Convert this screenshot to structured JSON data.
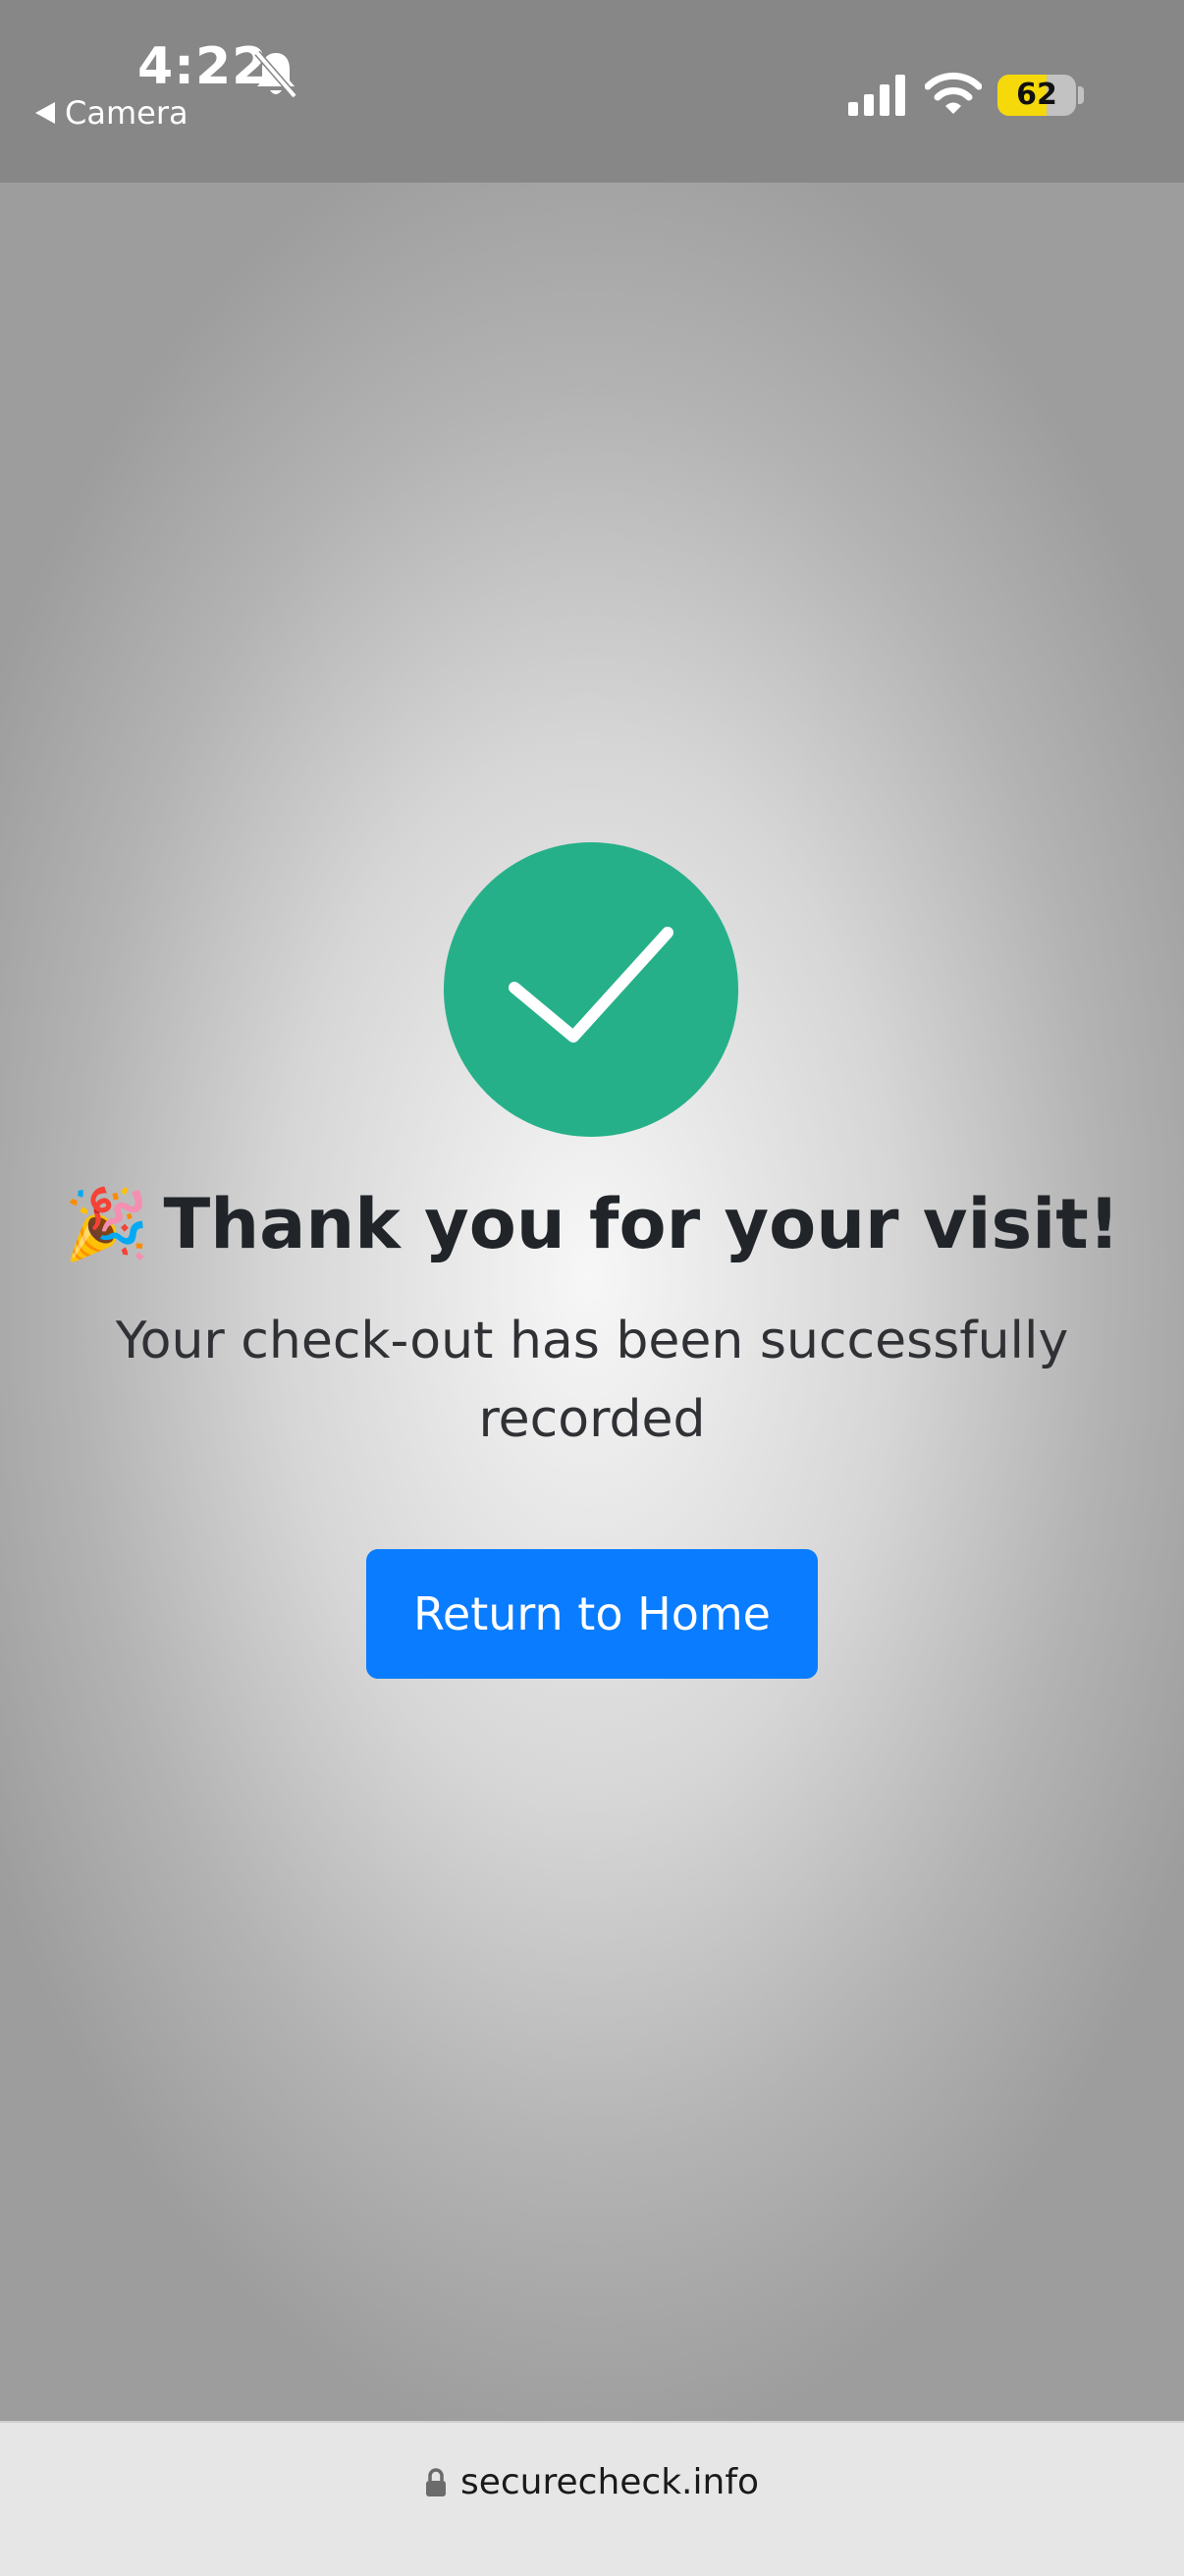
{
  "status_bar": {
    "time": "4:22",
    "back_label": "Camera",
    "battery_level": "62",
    "battery_fraction": 0.62,
    "icons": [
      "bell-slash-icon",
      "cellular-signal-icon",
      "wifi-icon",
      "battery-icon"
    ]
  },
  "main": {
    "success_icon": "checkmark-circle-icon",
    "success_color": "#26b089",
    "title_emoji": "🎉",
    "title": "Thank you for your visit!",
    "message": "Your check-out has been successfully recorded",
    "home_button_label": "Return to Home",
    "button_color": "#0a7cff"
  },
  "browser": {
    "url": "securecheck.info",
    "icons": [
      "lock-icon"
    ]
  }
}
